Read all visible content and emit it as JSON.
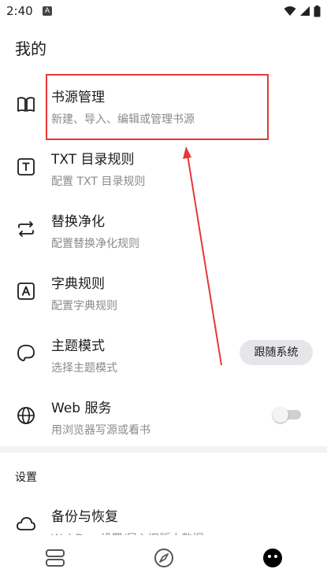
{
  "status_bar": {
    "time": "2:40",
    "notification": "A"
  },
  "page": {
    "title": "我的"
  },
  "items": [
    {
      "title": "书源管理",
      "subtitle": "新建、导入、编辑或管理书源",
      "icon": "book-open-icon"
    },
    {
      "title": "TXT 目录规则",
      "subtitle": "配置 TXT 目录规则",
      "icon": "txt-icon"
    },
    {
      "title": "替换净化",
      "subtitle": "配置替换净化规则",
      "icon": "replace-icon"
    },
    {
      "title": "字典规则",
      "subtitle": "配置字典规则",
      "icon": "dictionary-icon"
    },
    {
      "title": "主题模式",
      "subtitle": "选择主题模式",
      "icon": "theme-icon",
      "value": "跟随系统"
    },
    {
      "title": "Web 服务",
      "subtitle": "用浏览器写源或看书",
      "icon": "globe-icon",
      "toggle_on": false
    }
  ],
  "settings": {
    "section_title": "设置",
    "items": [
      {
        "title": "备份与恢复",
        "subtitle": "WebDav 设置/导入旧版本数据",
        "icon": "cloud-icon"
      }
    ]
  },
  "bottom_nav": [
    {
      "name": "bookshelf",
      "icon": "bookshelf-icon"
    },
    {
      "name": "discover",
      "icon": "compass-icon"
    },
    {
      "name": "my",
      "icon": "face-icon",
      "active": true
    }
  ],
  "colors": {
    "annotation": "#e53935",
    "chip_bg": "#e6e6ea",
    "subtitle": "#8a8a8f"
  }
}
